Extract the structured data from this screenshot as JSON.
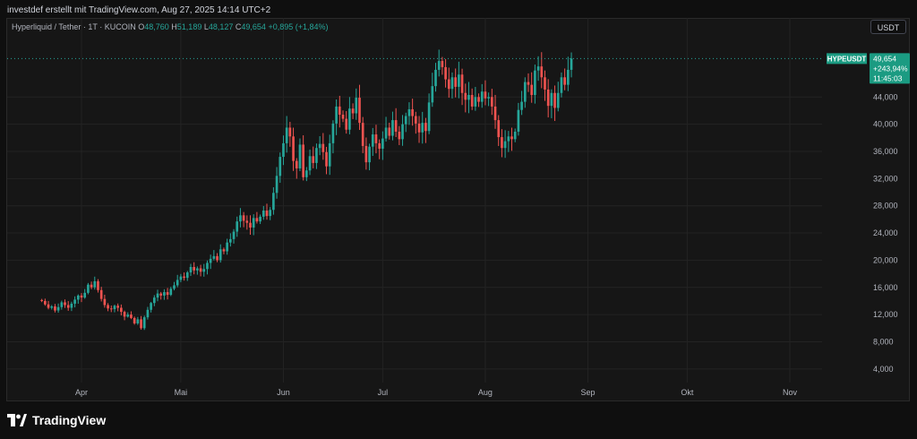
{
  "header": {
    "credit": "investdef erstellt mit TradingView.com, Aug 27, 2025 14:14 UTC+2"
  },
  "legend": {
    "symbol": "Hyperliquid / Tether · 1T · KUCOIN",
    "open_label": "O",
    "open": "48,760",
    "high_label": "H",
    "high": "51,189",
    "low_label": "L",
    "low": "48,127",
    "close_label": "C",
    "close": "49,654",
    "change": "+0,895 (+1,84%)"
  },
  "currency_button": "USDT",
  "price_tag": {
    "symbol": "HYPEUSDT",
    "price": "49,654",
    "change": "+243,94%",
    "countdown": "11:45:03"
  },
  "footer": {
    "brand": "TradingView"
  },
  "colors": {
    "up": "#26a69a",
    "down": "#ef5350",
    "grid": "#232323",
    "axis_text": "#b2b5be",
    "tag_bg": "#1b9b82"
  },
  "chart_data": {
    "type": "candlestick",
    "ylim": [
      2000,
      53000
    ],
    "y_ticks": [
      "44,000",
      "40,000",
      "36,000",
      "32,000",
      "28,000",
      "24,000",
      "20,000",
      "16,000",
      "12,000",
      "8,000",
      "4,000"
    ],
    "y_tick_values": [
      44000,
      40000,
      36000,
      32000,
      28000,
      24000,
      20000,
      16000,
      12000,
      8000,
      4000
    ],
    "x_ticks": [
      "Apr",
      "Mai",
      "Jun",
      "Jul",
      "Aug",
      "Sep",
      "Okt",
      "Nov"
    ],
    "x_tick_dates": [
      "2025-04-01",
      "2025-05-01",
      "2025-06-01",
      "2025-07-01",
      "2025-08-01",
      "2025-09-01",
      "2025-10-01",
      "2025-11-01"
    ],
    "last_price": 49654,
    "start_date": "2025-03-20",
    "close": [
      14000,
      13500,
      13000,
      13200,
      12600,
      13100,
      13800,
      13400,
      13000,
      13600,
      14200,
      14800,
      14500,
      15200,
      16400,
      16000,
      16900,
      15600,
      14300,
      13400,
      12900,
      12800,
      13300,
      13000,
      12400,
      11700,
      12000,
      11500,
      10700,
      11300,
      10000,
      11600,
      12700,
      13700,
      14500,
      15100,
      14800,
      15300,
      14900,
      15800,
      16300,
      17100,
      17600,
      17400,
      18200,
      19000,
      18500,
      18800,
      18300,
      18700,
      19600,
      20200,
      20600,
      20000,
      21600,
      21300,
      22600,
      23100,
      24200,
      25700,
      26600,
      25800,
      25500,
      24800,
      26200,
      25700,
      26400,
      27300,
      26500,
      27400,
      29900,
      32400,
      35200,
      37200,
      39500,
      38200,
      34600,
      33500,
      37000,
      32200,
      33200,
      35300,
      34300,
      36500,
      37100,
      35900,
      33800,
      37200,
      40100,
      42600,
      41400,
      40800,
      39200,
      42300,
      41600,
      43900,
      40200,
      36800,
      34400,
      36700,
      38500,
      37200,
      36400,
      37900,
      39500,
      38300,
      40600,
      38900,
      37800,
      40000,
      41200,
      42200,
      41200,
      40100,
      38800,
      40200,
      39000,
      43200,
      45600,
      48000,
      49300,
      48400,
      46600,
      45200,
      46900,
      45500,
      47300,
      44600,
      43600,
      44300,
      42600,
      44000,
      43300,
      44800,
      43800,
      44000,
      42600,
      40600,
      38100,
      36500,
      37500,
      38200,
      37800,
      38900,
      42100,
      43300,
      46200,
      45800,
      44300,
      47900,
      48500,
      46900,
      45100,
      42700,
      44600,
      42400,
      44600,
      46900,
      45800,
      48000,
      49654
    ]
  }
}
